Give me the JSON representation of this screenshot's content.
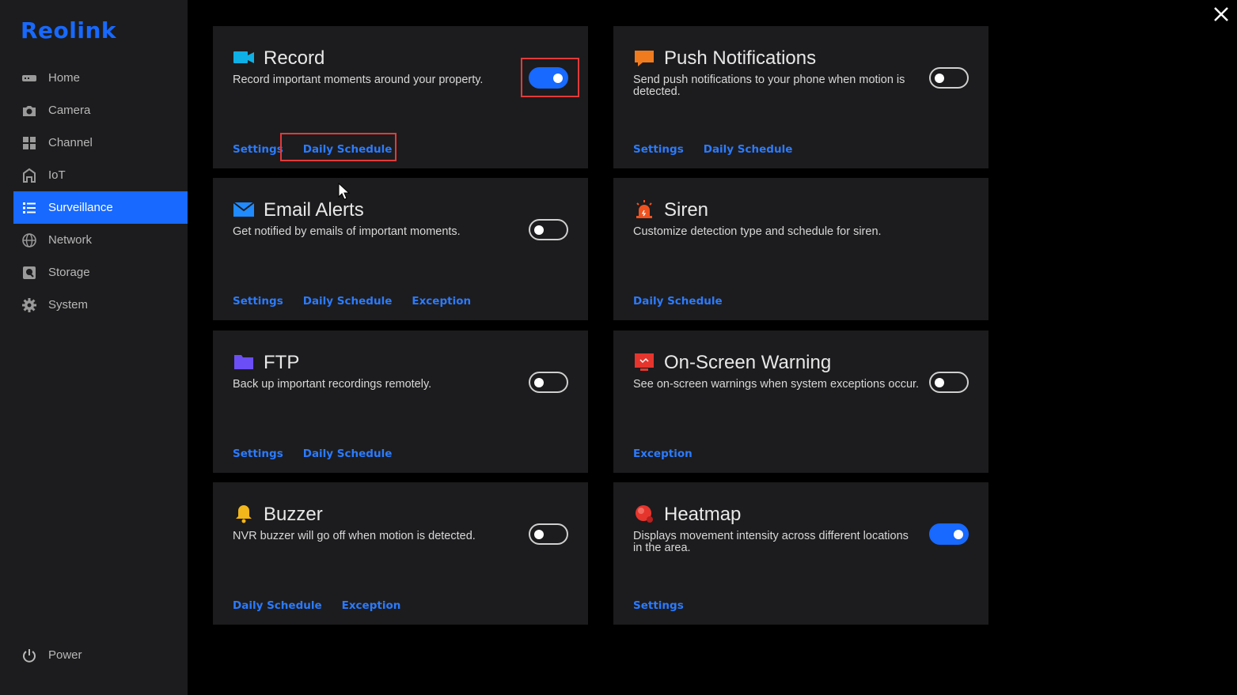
{
  "brand": {
    "name": "Reolink"
  },
  "sidebar": {
    "items": [
      {
        "label": "Home",
        "icon": "home-icon"
      },
      {
        "label": "Camera",
        "icon": "camera-icon"
      },
      {
        "label": "Channel",
        "icon": "channel-icon"
      },
      {
        "label": "IoT",
        "icon": "iot-icon"
      },
      {
        "label": "Surveillance",
        "icon": "list-icon",
        "active": true
      },
      {
        "label": "Network",
        "icon": "globe-icon"
      },
      {
        "label": "Storage",
        "icon": "storage-icon"
      },
      {
        "label": "System",
        "icon": "gear-icon"
      }
    ],
    "power_label": "Power"
  },
  "cards": {
    "record": {
      "title": "Record",
      "desc": "Record important moments around your property.",
      "enabled": true,
      "links": [
        "Settings",
        "Daily Schedule"
      ]
    },
    "push": {
      "title": "Push Notifications",
      "desc": "Send push notifications to your phone when motion is detected.",
      "enabled": false,
      "links": [
        "Settings",
        "Daily Schedule"
      ]
    },
    "email": {
      "title": "Email Alerts",
      "desc": "Get notified by emails of important moments.",
      "enabled": false,
      "links": [
        "Settings",
        "Daily Schedule",
        "Exception"
      ]
    },
    "siren": {
      "title": "Siren",
      "desc": "Customize detection type and schedule for siren.",
      "links": [
        "Daily Schedule"
      ]
    },
    "ftp": {
      "title": "FTP",
      "desc": "Back up important recordings remotely.",
      "enabled": false,
      "links": [
        "Settings",
        "Daily Schedule"
      ]
    },
    "onscreen": {
      "title": "On-Screen Warning",
      "desc": "See on-screen warnings when system exceptions occur.",
      "enabled": false,
      "links": [
        "Exception"
      ]
    },
    "buzzer": {
      "title": "Buzzer",
      "desc": "NVR buzzer will go off when motion is detected.",
      "enabled": false,
      "links": [
        "Daily Schedule",
        "Exception"
      ]
    },
    "heatmap": {
      "title": "Heatmap",
      "desc": "Displays movement intensity across different locations in the area.",
      "enabled": true,
      "links": [
        "Settings"
      ]
    }
  },
  "colors": {
    "accent": "#1769ff",
    "highlight": "#e23a3a",
    "card_bg": "#1c1c1e"
  }
}
